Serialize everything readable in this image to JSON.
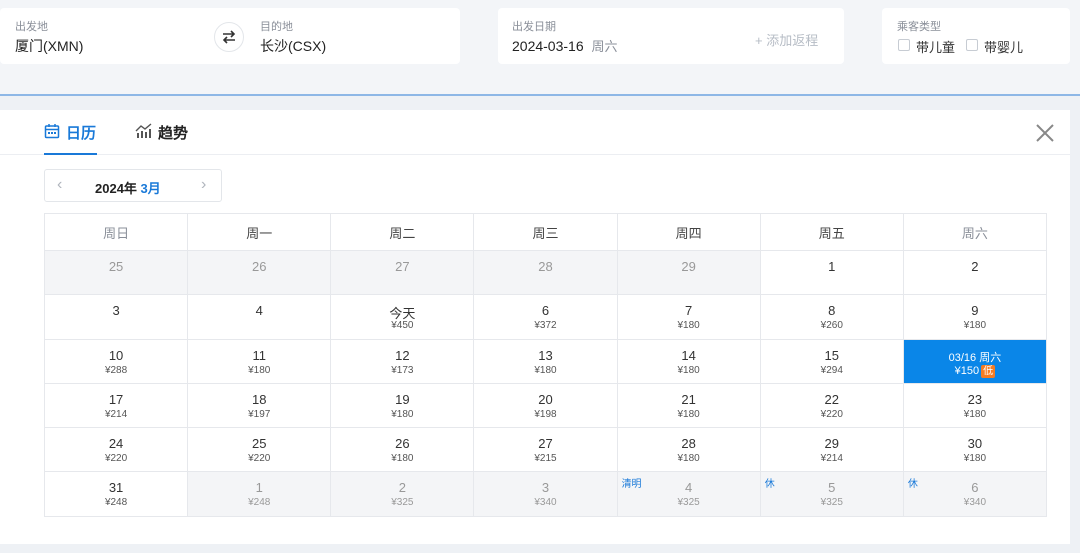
{
  "search": {
    "from_label": "出发地",
    "from_value": "厦门(XMN)",
    "to_label": "目的地",
    "to_value": "长沙(CSX)",
    "date_label": "出发日期",
    "date_value": "2024-03-16",
    "date_weekday": "周六",
    "add_return": "+ 添加返程",
    "passenger_label": "乘客类型",
    "child_label": "带儿童",
    "infant_label": "带婴儿"
  },
  "tabs": {
    "calendar": "日历",
    "trend": "趋势"
  },
  "nav": {
    "year": "2024年",
    "month": "3月"
  },
  "weekdays": [
    "周日",
    "周一",
    "周二",
    "周三",
    "周四",
    "周五",
    "周六"
  ],
  "weeks": [
    [
      {
        "d": "25",
        "p": ""
      },
      {
        "d": "26",
        "p": ""
      },
      {
        "d": "27",
        "p": ""
      },
      {
        "d": "28",
        "p": ""
      },
      {
        "d": "29",
        "p": ""
      },
      {
        "d": "1",
        "p": ""
      },
      {
        "d": "2",
        "p": ""
      }
    ],
    [
      {
        "d": "3",
        "p": ""
      },
      {
        "d": "4",
        "p": ""
      },
      {
        "d": "今天",
        "p": "¥450"
      },
      {
        "d": "6",
        "p": "¥372"
      },
      {
        "d": "7",
        "p": "¥180"
      },
      {
        "d": "8",
        "p": "¥260"
      },
      {
        "d": "9",
        "p": "¥180"
      }
    ],
    [
      {
        "d": "10",
        "p": "¥288"
      },
      {
        "d": "11",
        "p": "¥180"
      },
      {
        "d": "12",
        "p": "¥173"
      },
      {
        "d": "13",
        "p": "¥180"
      },
      {
        "d": "14",
        "p": "¥180"
      },
      {
        "d": "15",
        "p": "¥294"
      },
      {
        "d": "03/16 周六",
        "p": "¥150",
        "low": "低"
      }
    ],
    [
      {
        "d": "17",
        "p": "¥214"
      },
      {
        "d": "18",
        "p": "¥197"
      },
      {
        "d": "19",
        "p": "¥180"
      },
      {
        "d": "20",
        "p": "¥198"
      },
      {
        "d": "21",
        "p": "¥180"
      },
      {
        "d": "22",
        "p": "¥220"
      },
      {
        "d": "23",
        "p": "¥180"
      }
    ],
    [
      {
        "d": "24",
        "p": "¥220"
      },
      {
        "d": "25",
        "p": "¥220"
      },
      {
        "d": "26",
        "p": "¥180"
      },
      {
        "d": "27",
        "p": "¥215"
      },
      {
        "d": "28",
        "p": "¥180"
      },
      {
        "d": "29",
        "p": "¥214"
      },
      {
        "d": "30",
        "p": "¥180"
      }
    ],
    [
      {
        "d": "31",
        "p": "¥248"
      },
      {
        "d": "1",
        "p": "¥248"
      },
      {
        "d": "2",
        "p": "¥325"
      },
      {
        "d": "3",
        "p": "¥340"
      },
      {
        "d": "4",
        "p": "¥325",
        "hol": "清明"
      },
      {
        "d": "5",
        "p": "¥325",
        "hol": "休"
      },
      {
        "d": "6",
        "p": "¥340",
        "hol": "休"
      }
    ]
  ]
}
